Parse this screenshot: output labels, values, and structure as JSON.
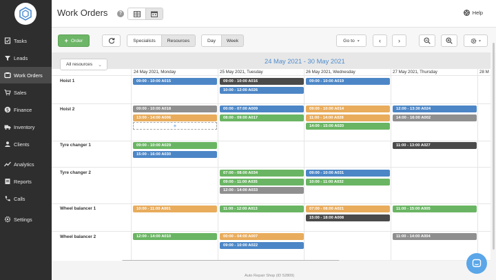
{
  "app": {
    "title": "Work Orders",
    "help_label": "Help"
  },
  "sidebar": {
    "items": [
      {
        "label": "Tasks",
        "icon": "tasks-icon"
      },
      {
        "label": "Leads",
        "icon": "leads-icon"
      },
      {
        "label": "Work Orders",
        "icon": "work-orders-icon"
      },
      {
        "label": "Sales",
        "icon": "cart-icon"
      },
      {
        "label": "Finance",
        "icon": "dollar-icon"
      },
      {
        "label": "Inventory",
        "icon": "truck-icon"
      },
      {
        "label": "Clients",
        "icon": "clients-icon"
      },
      {
        "label": "Analytics",
        "icon": "analytics-icon"
      },
      {
        "label": "Reports",
        "icon": "reports-icon"
      },
      {
        "label": "Calls",
        "icon": "phone-icon"
      },
      {
        "label": "Settings",
        "icon": "gear-icon"
      }
    ],
    "active": "Work Orders"
  },
  "toolbar": {
    "order_label": "Order",
    "specialists_label": "Specialists",
    "resources_label": "Resources",
    "day_label": "Day",
    "week_label": "Week",
    "goto_label": "Go to"
  },
  "calendar": {
    "range_title": "24 May 2021 - 30 May 2021",
    "resource_filter": "All resources",
    "days": [
      "24 May 2021, Monday",
      "25 May 2021, Tuesday",
      "26 May 2021, Wednesday",
      "27 May 2021, Thursday",
      "28 M"
    ],
    "resources": [
      "Hoist 1",
      "Hoist 2",
      "Tyre changer 1",
      "Tyre changer 2",
      "Wheel balancer 1",
      "Wheel balancer 2"
    ],
    "add_symbol": "+",
    "appointments": [
      {
        "resource": 0,
        "day": 0,
        "slot": 0,
        "text": "09:00 - 10:00  A015",
        "color": "#4c86c6"
      },
      {
        "resource": 0,
        "day": 1,
        "slot": 0,
        "text": "09:00 - 10:00  A016",
        "color": "#4a4a4a"
      },
      {
        "resource": 0,
        "day": 1,
        "slot": 1,
        "text": "10:00 - 12:00  A026",
        "color": "#4c86c6"
      },
      {
        "resource": 0,
        "day": 2,
        "slot": 0,
        "text": "09:00 - 10:00  A019",
        "color": "#4c86c6"
      },
      {
        "resource": 1,
        "day": 0,
        "slot": 0,
        "text": "09:00 - 10:00  A018",
        "color": "#8f8f8f"
      },
      {
        "resource": 1,
        "day": 0,
        "slot": 1,
        "text": "13:00 - 14:00  A006",
        "color": "#e8ac5c"
      },
      {
        "resource": 1,
        "day": 1,
        "slot": 0,
        "text": "00:00 - 07:00  A009",
        "color": "#4c86c6"
      },
      {
        "resource": 1,
        "day": 1,
        "slot": 1,
        "text": "08:00 - 09:00  A017",
        "color": "#6ab563"
      },
      {
        "resource": 1,
        "day": 2,
        "slot": 0,
        "text": "09:00 - 10:00  A014",
        "color": "#e8ac5c"
      },
      {
        "resource": 1,
        "day": 2,
        "slot": 1,
        "text": "11:00 - 14:00  A028",
        "color": "#e8ac5c"
      },
      {
        "resource": 1,
        "day": 2,
        "slot": 2,
        "text": "14:00 - 15:00  A020",
        "color": "#6ab563"
      },
      {
        "resource": 1,
        "day": 3,
        "slot": 0,
        "text": "12:00 - 13:30  A024",
        "color": "#4c86c6"
      },
      {
        "resource": 1,
        "day": 3,
        "slot": 1,
        "text": "14:00 - 16:00  A002",
        "color": "#8f8f8f"
      },
      {
        "resource": 2,
        "day": 0,
        "slot": 0,
        "text": "09:00 - 10:00  A029",
        "color": "#6ab563"
      },
      {
        "resource": 2,
        "day": 0,
        "slot": 1,
        "text": "15:00 - 16:00  A030",
        "color": "#4c86c6"
      },
      {
        "resource": 2,
        "day": 3,
        "slot": 0,
        "text": "11:00 - 13:00  A027",
        "color": "#4a4a4a"
      },
      {
        "resource": 3,
        "day": 1,
        "slot": 0,
        "text": "07:00 - 08:00  A034",
        "color": "#6ab563"
      },
      {
        "resource": 3,
        "day": 1,
        "slot": 1,
        "text": "09:00 - 11:00  A035",
        "color": "#6ab563"
      },
      {
        "resource": 3,
        "day": 1,
        "slot": 2,
        "text": "12:00 - 14:00  A033",
        "color": "#8f8f8f"
      },
      {
        "resource": 3,
        "day": 2,
        "slot": 0,
        "text": "09:00 - 10:00  A031",
        "color": "#4c86c6"
      },
      {
        "resource": 3,
        "day": 2,
        "slot": 1,
        "text": "10:00 - 11:00  A032",
        "color": "#6ab563"
      },
      {
        "resource": 4,
        "day": 0,
        "slot": 0,
        "text": "10:00 - 11:00  A001",
        "color": "#e8ac5c"
      },
      {
        "resource": 4,
        "day": 1,
        "slot": 0,
        "text": "11:00 - 12:00  A013",
        "color": "#6ab563"
      },
      {
        "resource": 4,
        "day": 2,
        "slot": 0,
        "text": "07:00 - 08:00  A021",
        "color": "#e8ac5c"
      },
      {
        "resource": 4,
        "day": 2,
        "slot": 1,
        "text": "15:00 - 18:00  A008",
        "color": "#4a4a4a"
      },
      {
        "resource": 4,
        "day": 3,
        "slot": 0,
        "text": "11:00 - 15:00  A005",
        "color": "#6ab563"
      },
      {
        "resource": 5,
        "day": 0,
        "slot": 0,
        "text": "12:00 - 14:00  A010",
        "color": "#6ab563"
      },
      {
        "resource": 5,
        "day": 1,
        "slot": 0,
        "text": "00:00 - 04:00  A007",
        "color": "#e8ac5c"
      },
      {
        "resource": 5,
        "day": 1,
        "slot": 1,
        "text": "09:00 - 10:00  A022",
        "color": "#4c86c6"
      },
      {
        "resource": 5,
        "day": 3,
        "slot": 0,
        "text": "11:00 - 14:00  A004",
        "color": "#8f8f8f"
      }
    ]
  },
  "footer": {
    "text": "Auto Repair Shop (ID 52809)"
  }
}
